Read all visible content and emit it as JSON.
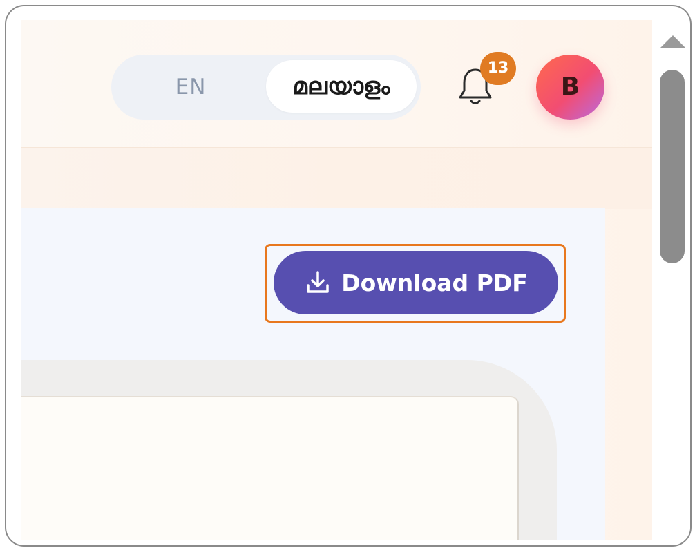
{
  "header": {
    "language_toggle": {
      "options": [
        "EN",
        "മലയാളം"
      ],
      "selected": "മലയാളം"
    },
    "notifications": {
      "icon": "bell-icon",
      "count": "13"
    },
    "user_avatar": {
      "initial": "B"
    }
  },
  "main": {
    "download_button": {
      "icon": "download-icon",
      "label": "Download PDF"
    }
  },
  "colors": {
    "primary_button": "#574fb0",
    "badge": "#e07b23",
    "highlight_outline": "#e8781e"
  }
}
